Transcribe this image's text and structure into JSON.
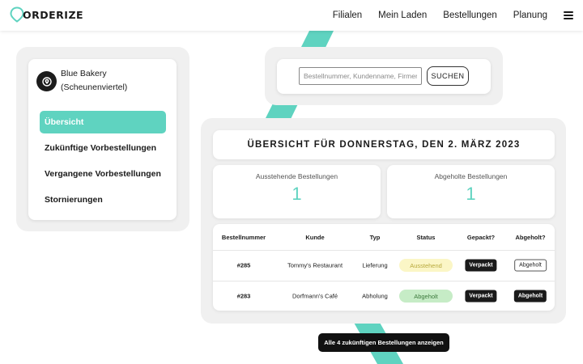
{
  "header": {
    "logo_text": "ORDERIZE",
    "nav": [
      "Filialen",
      "Mein Laden",
      "Bestellungen",
      "Planung"
    ],
    "menu_icon": "hamburger-menu-icon"
  },
  "store": {
    "name_line1": "Blue Bakery",
    "name_line2": "(Scheunenviertel)",
    "icon": "location-pin-icon",
    "menu": [
      "Übersicht",
      "Zukünftige Vorbestellungen",
      "Vergangene Vorbestellungen",
      "Stornierungen"
    ],
    "active_index": 0
  },
  "search": {
    "placeholder": "Bestellnummer, Kundenname, Firmenname",
    "button_label": "SUCHEN"
  },
  "overview": {
    "title": "ÜBERSICHT FÜR DONNERSTAG, DEN 2. MÄRZ 2023",
    "stats": [
      {
        "label": "Ausstehende Bestellungen",
        "value": "1"
      },
      {
        "label": "Abgeholte Bestellungen",
        "value": "1"
      }
    ],
    "table": {
      "headers": [
        "Bestellnummer",
        "Kunde",
        "Typ",
        "Status",
        "Gepackt?",
        "Abgeholt?"
      ],
      "rows": [
        {
          "number": "#285",
          "customer": "Tommy's Restaurant",
          "type": "Lieferung",
          "status": "Ausstehend",
          "packed": "Verpackt",
          "picked": "Abgeholt"
        },
        {
          "number": "#283",
          "customer": "Dorfmann's Café",
          "type": "Abholung",
          "status": "Abgeholt",
          "packed": "Verpackt",
          "picked": "Abgeholt"
        }
      ]
    },
    "show_all_button": "Alle 4 zukünftigen Bestellungen anzeigen"
  },
  "colors": {
    "accent": "#5fd3c0",
    "status_pending_bg": "#fbf6c6",
    "status_picked_bg": "#c6ecc6",
    "dark": "#1a1a1a"
  }
}
